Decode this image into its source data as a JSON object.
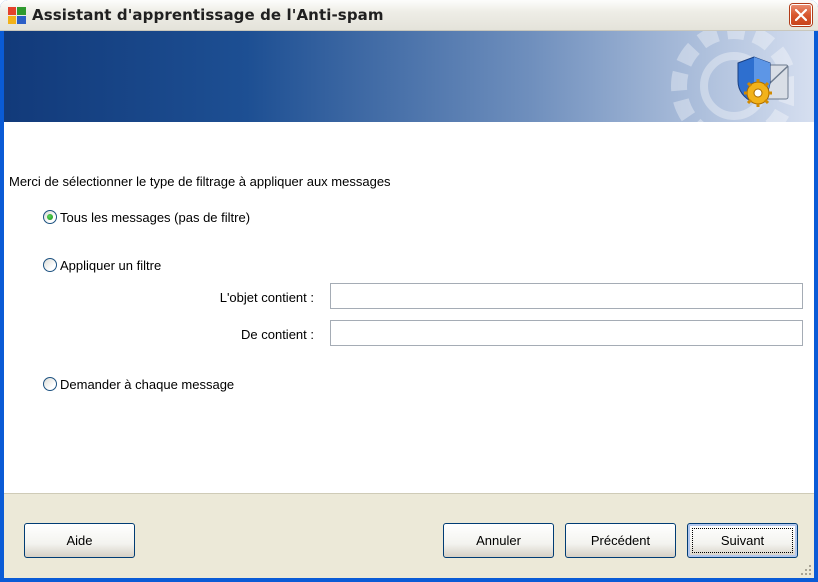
{
  "window": {
    "title": "Assistant d'apprentissage de l'Anti-spam"
  },
  "content": {
    "instruction": "Merci de sélectionner le type de filtrage à appliquer aux messages",
    "options": [
      {
        "label": "Tous les messages (pas de filtre)",
        "checked": true
      },
      {
        "label": "Appliquer un filtre",
        "checked": false
      },
      {
        "label": "Demander à chaque message",
        "checked": false
      }
    ],
    "subject_label": "L'objet contient :",
    "subject_value": "",
    "from_label": "De contient :",
    "from_value": ""
  },
  "footer": {
    "help_label": "Aide",
    "cancel_label": "Annuler",
    "previous_label": "Précédent",
    "next_label": "Suivant"
  },
  "colors": {
    "title_bar": "#eeede6",
    "banner_dark": "#123a7a",
    "footer": "#ece9d8",
    "radio_checked": "#21a121",
    "close_button": "#d8572e"
  }
}
